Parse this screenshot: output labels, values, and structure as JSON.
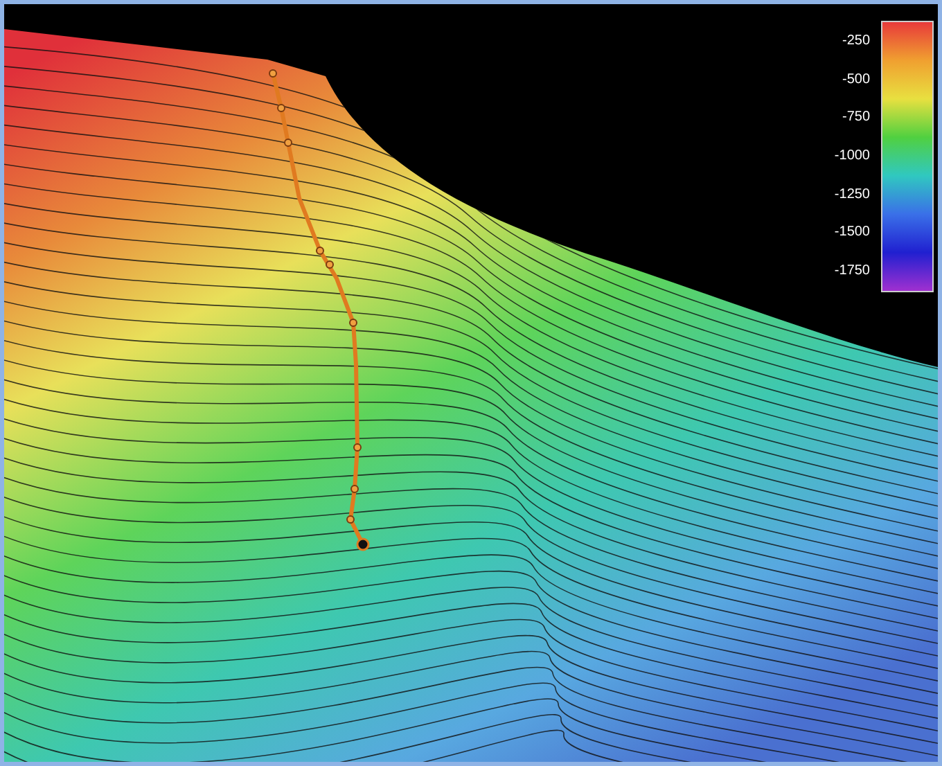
{
  "legend": {
    "labels": [
      "-250",
      "-500",
      "-750",
      "-1000",
      "-1250",
      "-1500",
      "-1750"
    ]
  }
}
